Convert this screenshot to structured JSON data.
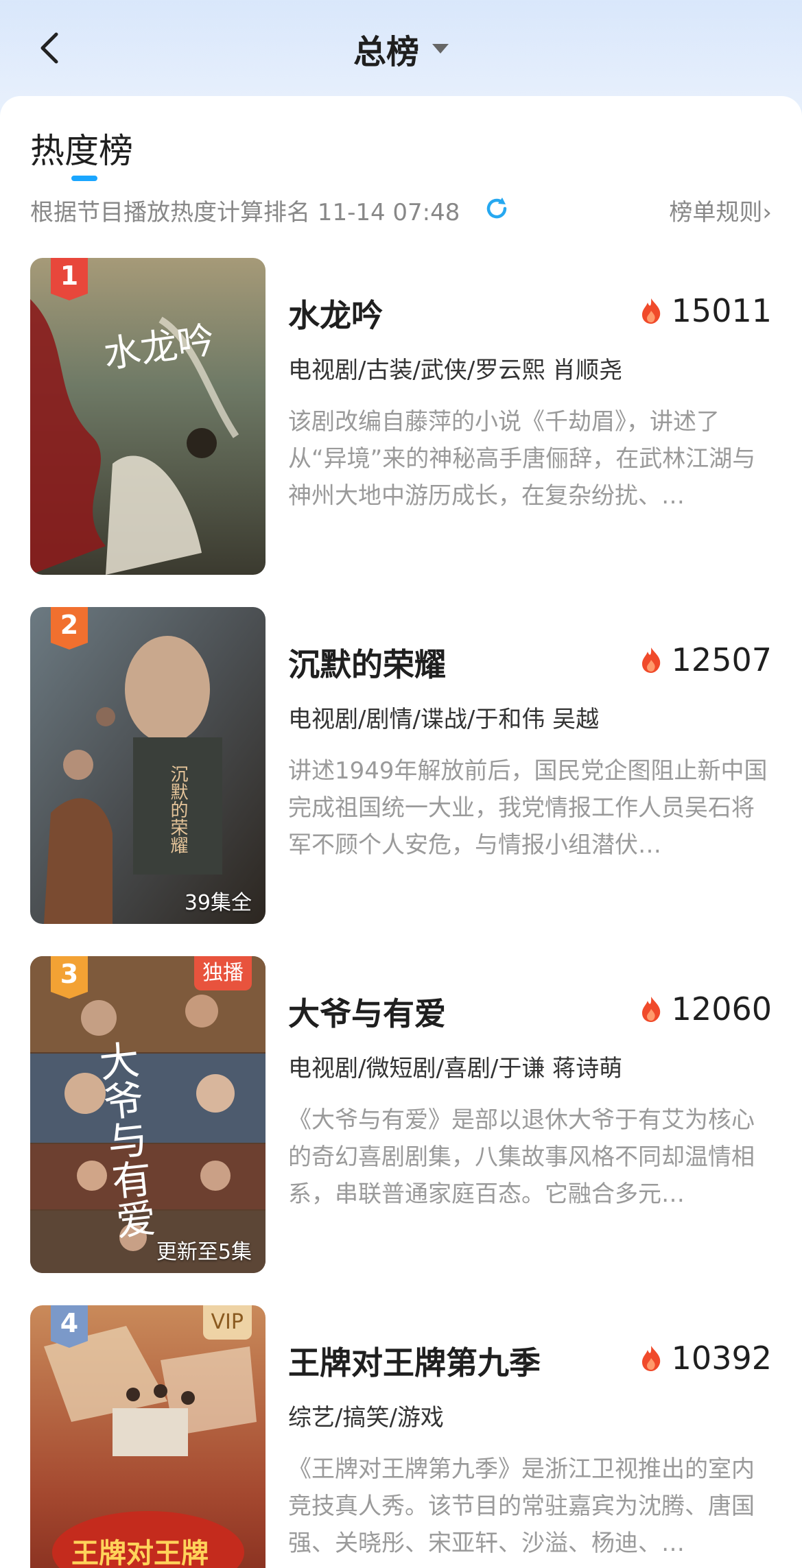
{
  "header": {
    "title": "总榜"
  },
  "tab": {
    "title": "热度榜"
  },
  "subheader": {
    "text": "根据节目播放热度计算排名 11-14 07:48",
    "rules_link": "榜单规则›"
  },
  "colors": {
    "accent_blue": "#1aa6ff",
    "flame": "#f04a2a",
    "rank1": "#e8473b",
    "rank2": "#f1702f",
    "rank3": "#f3a234",
    "rank4": "#7b99c9"
  },
  "items": [
    {
      "rank": "1",
      "title": "水龙吟",
      "heat": "15011",
      "meta": "电视剧/古装/武侠/罗云熙 肖顺尧",
      "description": "该剧改编自藤萍的小说《千劫眉》，讲述了从“异境”来的神秘高手唐俪辞，在武林江湖与神州大地中游历成长，在复杂纷扰、…",
      "poster_text": "水龙吟",
      "corner_tag": "",
      "episode": ""
    },
    {
      "rank": "2",
      "title": "沉默的荣耀",
      "heat": "12507",
      "meta": "电视剧/剧情/谍战/于和伟 吴越",
      "description": "讲述1949年解放前后，国民党企图阻止新中国完成祖国统一大业，我党情报工作人员吴石将军不顾个人安危，与情报小组潜伏…",
      "poster_text": "沉默的荣耀",
      "corner_tag": "",
      "episode": "39集全"
    },
    {
      "rank": "3",
      "title": "大爷与有爱",
      "heat": "12060",
      "meta": "电视剧/微短剧/喜剧/于谦 蒋诗萌",
      "description": "《大爷与有爱》是部以退休大爷于有艾为核心的奇幻喜剧剧集，八集故事风格不同却温情相系，串联普通家庭百态。它融合多元…",
      "poster_text": "大爷与有爱",
      "corner_tag": "独播",
      "episode": "更新至5集"
    },
    {
      "rank": "4",
      "title": "王牌对王牌第九季",
      "heat": "10392",
      "meta": "综艺/搞笑/游戏",
      "description": "《王牌对王牌第九季》是浙江卫视推出的室内竞技真人秀。该节目的常驻嘉宾为沈腾、唐国强、关晓彤、宋亚轩、沙溢、杨迪、…",
      "poster_text": "王牌对王牌",
      "corner_tag": "VIP",
      "episode": ""
    }
  ]
}
